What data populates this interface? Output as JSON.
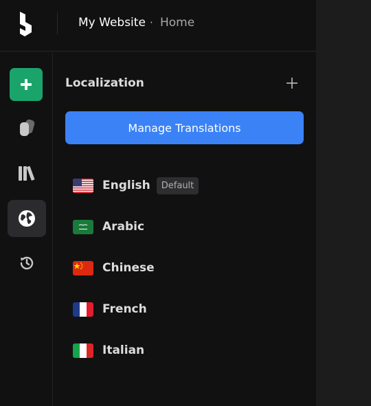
{
  "header": {
    "site_name": "My Website",
    "separator": "·",
    "page": "Home"
  },
  "rail": {
    "items": [
      {
        "name": "add",
        "icon": "plus-icon"
      },
      {
        "name": "pages",
        "icon": "pages-icon"
      },
      {
        "name": "library",
        "icon": "library-icon"
      },
      {
        "name": "localization",
        "icon": "globe-icon",
        "active": true
      },
      {
        "name": "history",
        "icon": "history-icon"
      }
    ]
  },
  "panel": {
    "title": "Localization",
    "add_icon": "plus-icon",
    "manage_button": "Manage Translations",
    "languages": [
      {
        "label": "English",
        "flag": "us-flag-icon",
        "badge": "Default"
      },
      {
        "label": "Arabic",
        "flag": "saudi-flag-icon"
      },
      {
        "label": "Chinese",
        "flag": "china-flag-icon"
      },
      {
        "label": "French",
        "flag": "france-flag-icon"
      },
      {
        "label": "Italian",
        "flag": "italy-flag-icon"
      }
    ]
  },
  "colors": {
    "accent_green": "#1aa46c",
    "primary_blue": "#3b82f6",
    "background": "#111112"
  }
}
